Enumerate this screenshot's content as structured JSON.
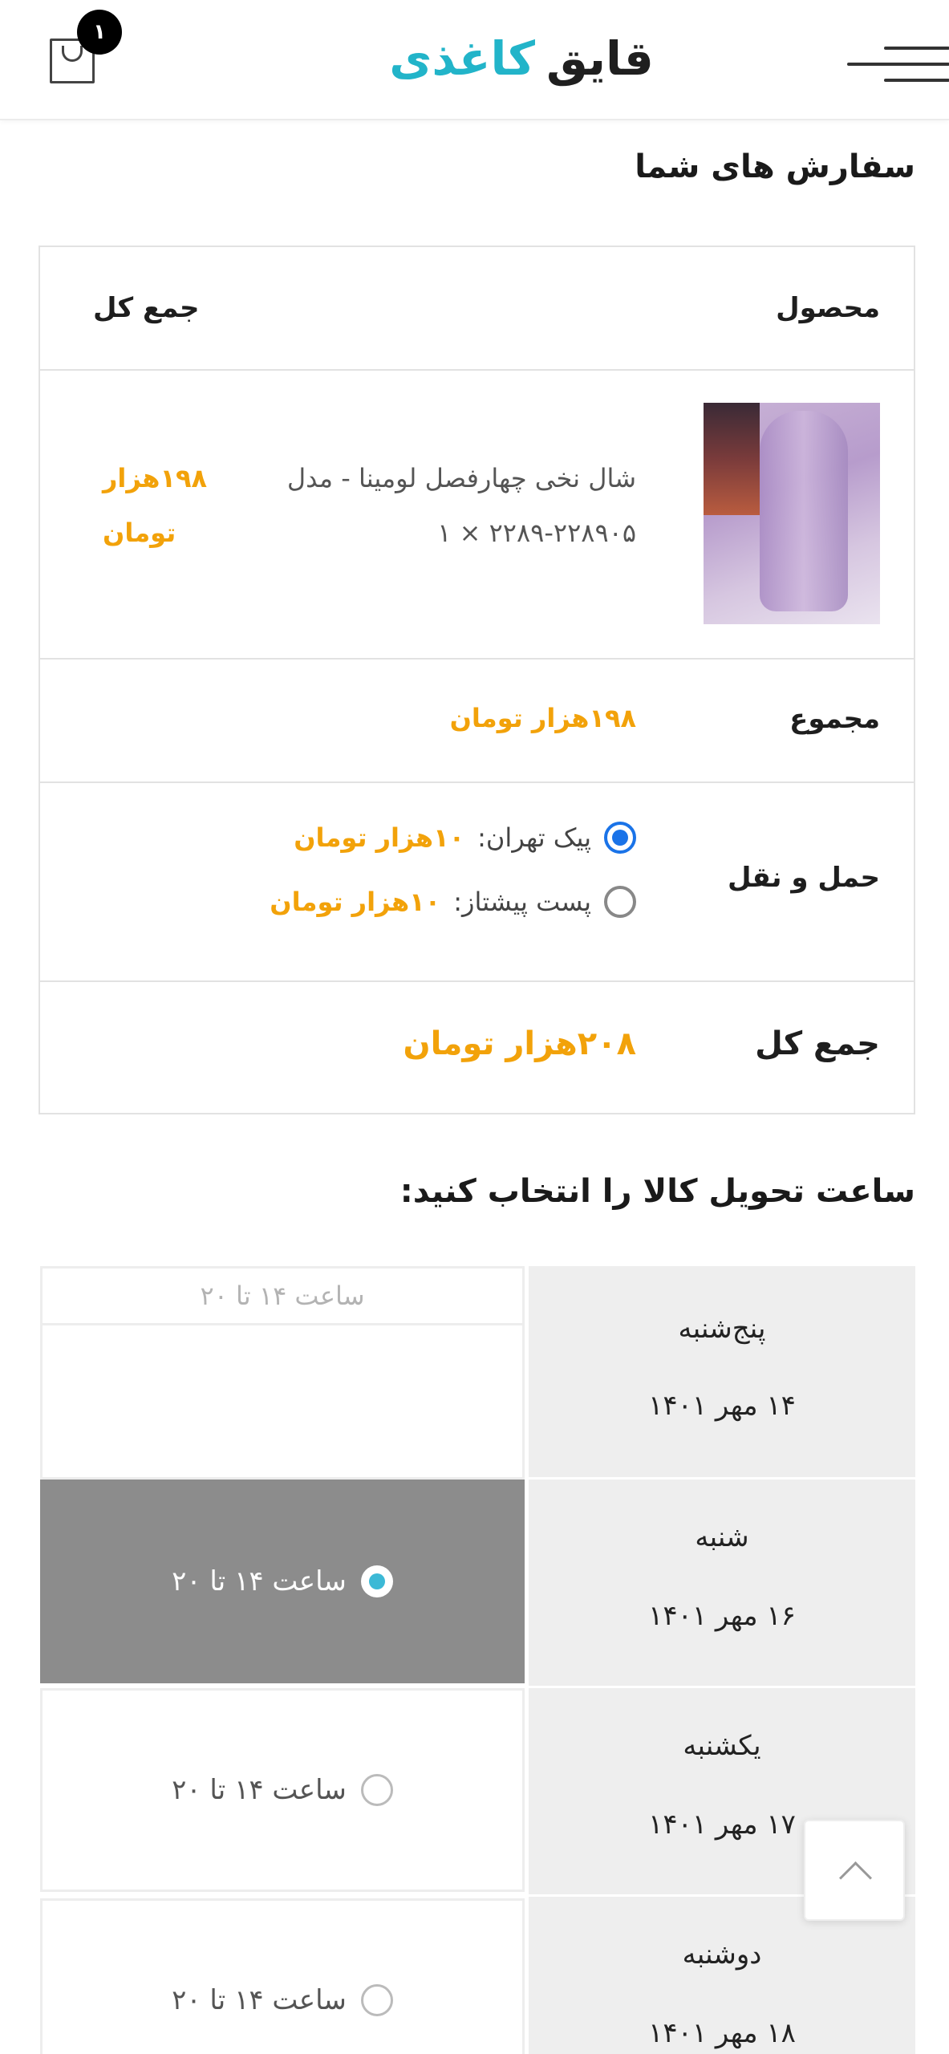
{
  "header": {
    "logo_part1": "قایق",
    "logo_part2": "کاغذی",
    "cart_count": "۱"
  },
  "orders_title": "سفارش های شما",
  "table": {
    "col_product": "محصول",
    "col_total": "جمع کل",
    "product_name_line1": "شال نخی چهارفصل لومینا - مدل",
    "product_name_line2": "۲۲۸۹-۲۲۸۹۰۵ × ۱",
    "product_price_line1": "۱۹۸هزار",
    "product_price_line2": "تومان",
    "subtotal_label": "مجموع",
    "subtotal_value": "۱۹۸هزار تومان",
    "shipping_label": "حمل و نقل",
    "shipping_options": [
      {
        "label": "پیک تهران:",
        "price": "۱۰هزار تومان",
        "selected": true
      },
      {
        "label": "پست پیشتاز:",
        "price": "۱۰هزار تومان",
        "selected": false
      }
    ],
    "grand_total_label": "جمع کل",
    "grand_total_value": "۲۰۸هزار تومان"
  },
  "delivery_title": "ساعت تحویل کالا را انتخاب کنید:",
  "delivery": [
    {
      "day": "پنج‌شنبه",
      "date": "۱۴ مهر ۱۴۰۱",
      "slot": "ساعت ۱۴ تا ۲۰",
      "state": "disabled"
    },
    {
      "day": "شنبه",
      "date": "۱۶ مهر ۱۴۰۱",
      "slot": "ساعت ۱۴ تا ۲۰",
      "state": "selected"
    },
    {
      "day": "یکشنبه",
      "date": "۱۷ مهر ۱۴۰۱",
      "slot": "ساعت ۱۴ تا ۲۰",
      "state": "available"
    },
    {
      "day": "دوشنبه",
      "date": "۱۸ مهر ۱۴۰۱",
      "slot": "ساعت ۱۴ تا ۲۰",
      "state": "available"
    }
  ],
  "colors": {
    "accent_teal": "#22b4c9",
    "price_orange": "#f2a20a",
    "radio_blue": "#1a73e8",
    "selected_slot": "#8c8c8c"
  },
  "icons": [
    "cart-icon",
    "menu-icon",
    "chevron-up-icon"
  ]
}
